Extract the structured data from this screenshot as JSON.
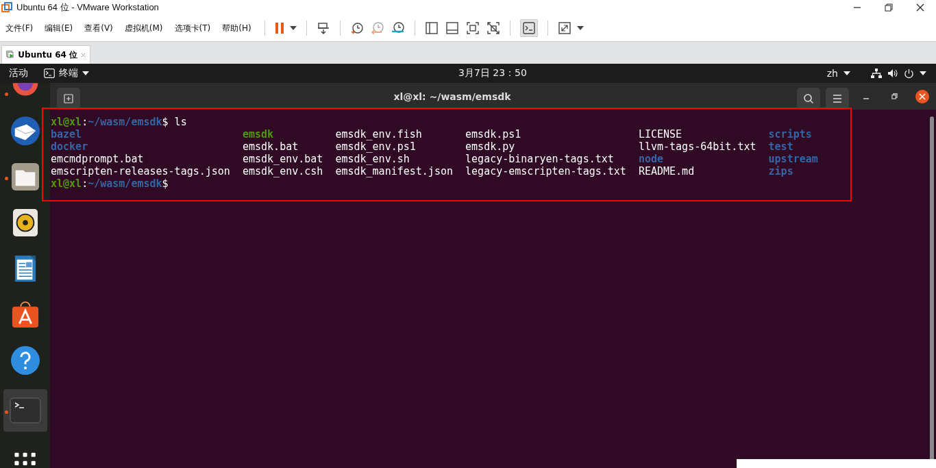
{
  "window": {
    "title": "Ubuntu 64 位 - VMware Workstation"
  },
  "menu": [
    "文件(F)",
    "编辑(E)",
    "查看(V)",
    "虚拟机(M)",
    "选项卡(T)",
    "帮助(H)"
  ],
  "tabs": [
    {
      "label": "Ubuntu 64 位",
      "selected": true
    }
  ],
  "topbar": {
    "activities": "活动",
    "app": "终端",
    "clock": "3月7日  23：50",
    "input": "zh"
  },
  "dock": [
    {
      "kind": "firefox",
      "running": true
    },
    {
      "kind": "mail",
      "running": false
    },
    {
      "kind": "files",
      "running": true
    },
    {
      "kind": "music",
      "running": false
    },
    {
      "kind": "writer",
      "running": false
    },
    {
      "kind": "store",
      "running": false
    },
    {
      "kind": "help",
      "running": false
    },
    {
      "kind": "terminal",
      "running": true,
      "selected": true
    },
    {
      "kind": "apps",
      "running": false
    }
  ],
  "terminal": {
    "title": "xl@xl: ~/wasm/emsdk",
    "prompt": {
      "user": "xl@xl",
      "separator": ":",
      "path": "~/wasm/emsdk",
      "symbol": "$",
      "command": "ls"
    },
    "listing": [
      [
        {
          "name": "bazel",
          "kind": "dir"
        },
        {
          "name": "emsdk",
          "kind": "exec"
        },
        {
          "name": "emsdk_env.fish",
          "kind": "file"
        },
        {
          "name": "emsdk.ps1",
          "kind": "file"
        },
        {
          "name": "LICENSE",
          "kind": "file"
        },
        {
          "name": "scripts",
          "kind": "dir"
        }
      ],
      [
        {
          "name": "docker",
          "kind": "dir"
        },
        {
          "name": "emsdk.bat",
          "kind": "file"
        },
        {
          "name": "emsdk_env.ps1",
          "kind": "file"
        },
        {
          "name": "emsdk.py",
          "kind": "file"
        },
        {
          "name": "llvm-tags-64bit.txt",
          "kind": "file"
        },
        {
          "name": "test",
          "kind": "dir"
        }
      ],
      [
        {
          "name": "emcmdprompt.bat",
          "kind": "file"
        },
        {
          "name": "emsdk_env.bat",
          "kind": "file"
        },
        {
          "name": "emsdk_env.sh",
          "kind": "file"
        },
        {
          "name": "legacy-binaryen-tags.txt",
          "kind": "file"
        },
        {
          "name": "node",
          "kind": "dir"
        },
        {
          "name": "upstream",
          "kind": "dir"
        }
      ],
      [
        {
          "name": "emscripten-releases-tags.json",
          "kind": "file"
        },
        {
          "name": "emsdk_env.csh",
          "kind": "file"
        },
        {
          "name": "emsdk_manifest.json",
          "kind": "file"
        },
        {
          "name": "legacy-emscripten-tags.txt",
          "kind": "file"
        },
        {
          "name": "README.md",
          "kind": "file"
        },
        {
          "name": "zips",
          "kind": "dir"
        }
      ]
    ],
    "prompt2": {
      "user": "xl@xl",
      "separator": ":",
      "path": "~/wasm/emsdk",
      "symbol": "$"
    }
  }
}
